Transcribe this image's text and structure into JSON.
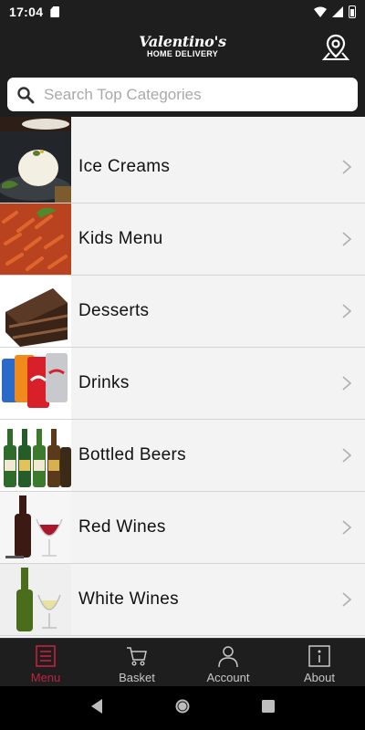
{
  "status_bar": {
    "time": "17:04"
  },
  "header": {
    "logo_script": "Valentino's",
    "logo_sub": "HOME DELIVERY"
  },
  "search": {
    "placeholder": "Search Top Categories"
  },
  "categories": [
    {
      "label": "Ice Creams",
      "icon": "ice-cream-photo"
    },
    {
      "label": "Kids Menu",
      "icon": "pasta-photo"
    },
    {
      "label": "Desserts",
      "icon": "cake-photo"
    },
    {
      "label": "Drinks",
      "icon": "soda-cans-photo"
    },
    {
      "label": "Bottled Beers",
      "icon": "beer-bottles-photo"
    },
    {
      "label": "Red Wines",
      "icon": "red-wine-photo"
    },
    {
      "label": "White Wines",
      "icon": "white-wine-photo"
    }
  ],
  "bottom_nav": {
    "menu": "Menu",
    "basket": "Basket",
    "account": "Account",
    "about": "About"
  },
  "colors": {
    "header_bg": "#1e1e1e",
    "accent": "#c0223f",
    "list_bg": "#f3f3f3"
  }
}
